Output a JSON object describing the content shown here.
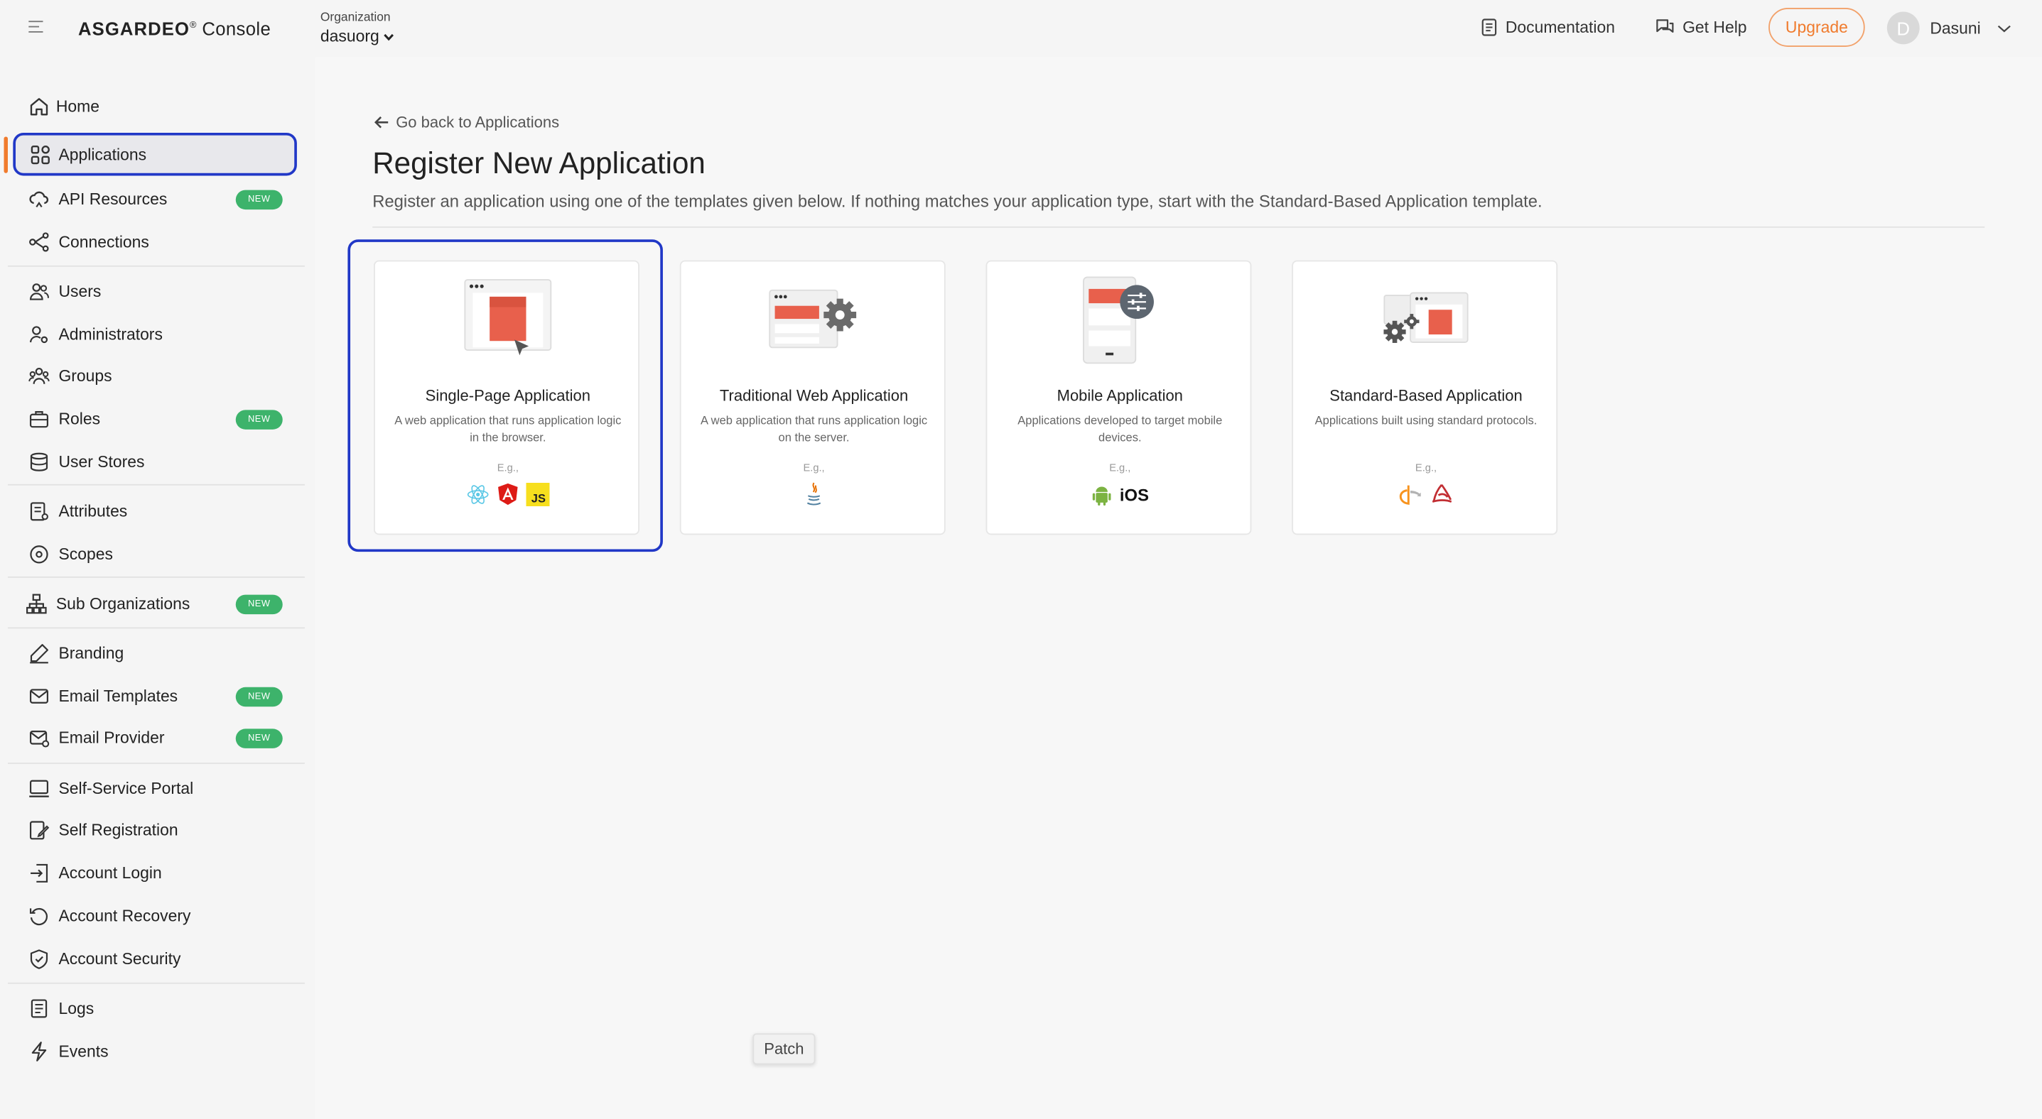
{
  "header": {
    "brand": "ASGARDEO",
    "brand_mark": "®",
    "app_name": "Console",
    "org_label": "Organization",
    "org_value": "dasuorg",
    "documentation": "Documentation",
    "get_help": "Get Help",
    "upgrade": "Upgrade",
    "user_initial": "D",
    "user_name": "Dasuni"
  },
  "sidebar": {
    "items": [
      {
        "label": "Home",
        "icon": "home-icon"
      },
      {
        "label": "Applications",
        "icon": "applications-grid-icon",
        "active": true
      },
      {
        "label": "API Resources",
        "icon": "api-resources-icon",
        "badge": "NEW"
      },
      {
        "label": "Connections",
        "icon": "connections-icon"
      },
      {
        "label": "Users",
        "icon": "users-icon"
      },
      {
        "label": "Administrators",
        "icon": "administrators-icon"
      },
      {
        "label": "Groups",
        "icon": "groups-icon"
      },
      {
        "label": "Roles",
        "icon": "roles-icon",
        "badge": "NEW"
      },
      {
        "label": "User Stores",
        "icon": "user-stores-icon"
      },
      {
        "label": "Attributes",
        "icon": "attributes-icon"
      },
      {
        "label": "Scopes",
        "icon": "scopes-icon"
      },
      {
        "label": "Sub Organizations",
        "icon": "sub-organizations-icon",
        "badge": "NEW"
      },
      {
        "label": "Branding",
        "icon": "branding-icon"
      },
      {
        "label": "Email Templates",
        "icon": "email-templates-icon",
        "badge": "NEW"
      },
      {
        "label": "Email Provider",
        "icon": "email-provider-icon",
        "badge": "NEW"
      },
      {
        "label": "Self-Service Portal",
        "icon": "self-service-portal-icon"
      },
      {
        "label": "Self Registration",
        "icon": "self-registration-icon"
      },
      {
        "label": "Account Login",
        "icon": "account-login-icon"
      },
      {
        "label": "Account Recovery",
        "icon": "account-recovery-icon"
      },
      {
        "label": "Account Security",
        "icon": "account-security-icon"
      },
      {
        "label": "Logs",
        "icon": "logs-icon"
      },
      {
        "label": "Events",
        "icon": "events-icon"
      }
    ]
  },
  "main": {
    "back_link": "Go back to Applications",
    "title": "Register New Application",
    "subtitle": "Register an application using one of the templates given below. If nothing matches your application type, start with the Standard-Based Application template.",
    "templates": [
      {
        "name": "Single-Page Application",
        "description": "A web application that runs application logic in the browser.",
        "eg": "E.g.,",
        "selected": true,
        "examples": [
          "react-icon",
          "angular-icon",
          "javascript-icon"
        ]
      },
      {
        "name": "Traditional Web Application",
        "description": "A web application that runs application logic on the server.",
        "eg": "E.g.,",
        "examples": [
          "java-icon"
        ]
      },
      {
        "name": "Mobile Application",
        "description": "Applications developed to target mobile devices.",
        "eg": "E.g.,",
        "examples": [
          "android-icon",
          "ios-label"
        ],
        "ios_text": "iOS"
      },
      {
        "name": "Standard-Based Application",
        "description": "Applications built using standard protocols.",
        "eg": "E.g.,",
        "examples": [
          "openid-icon",
          "saml-icon"
        ]
      }
    ],
    "patch_button": "Patch"
  },
  "colors": {
    "accent_blue": "#2138c7",
    "accent_orange": "#f07b2d",
    "badge_green": "#3db36b",
    "illustration_red": "#e8604c"
  }
}
